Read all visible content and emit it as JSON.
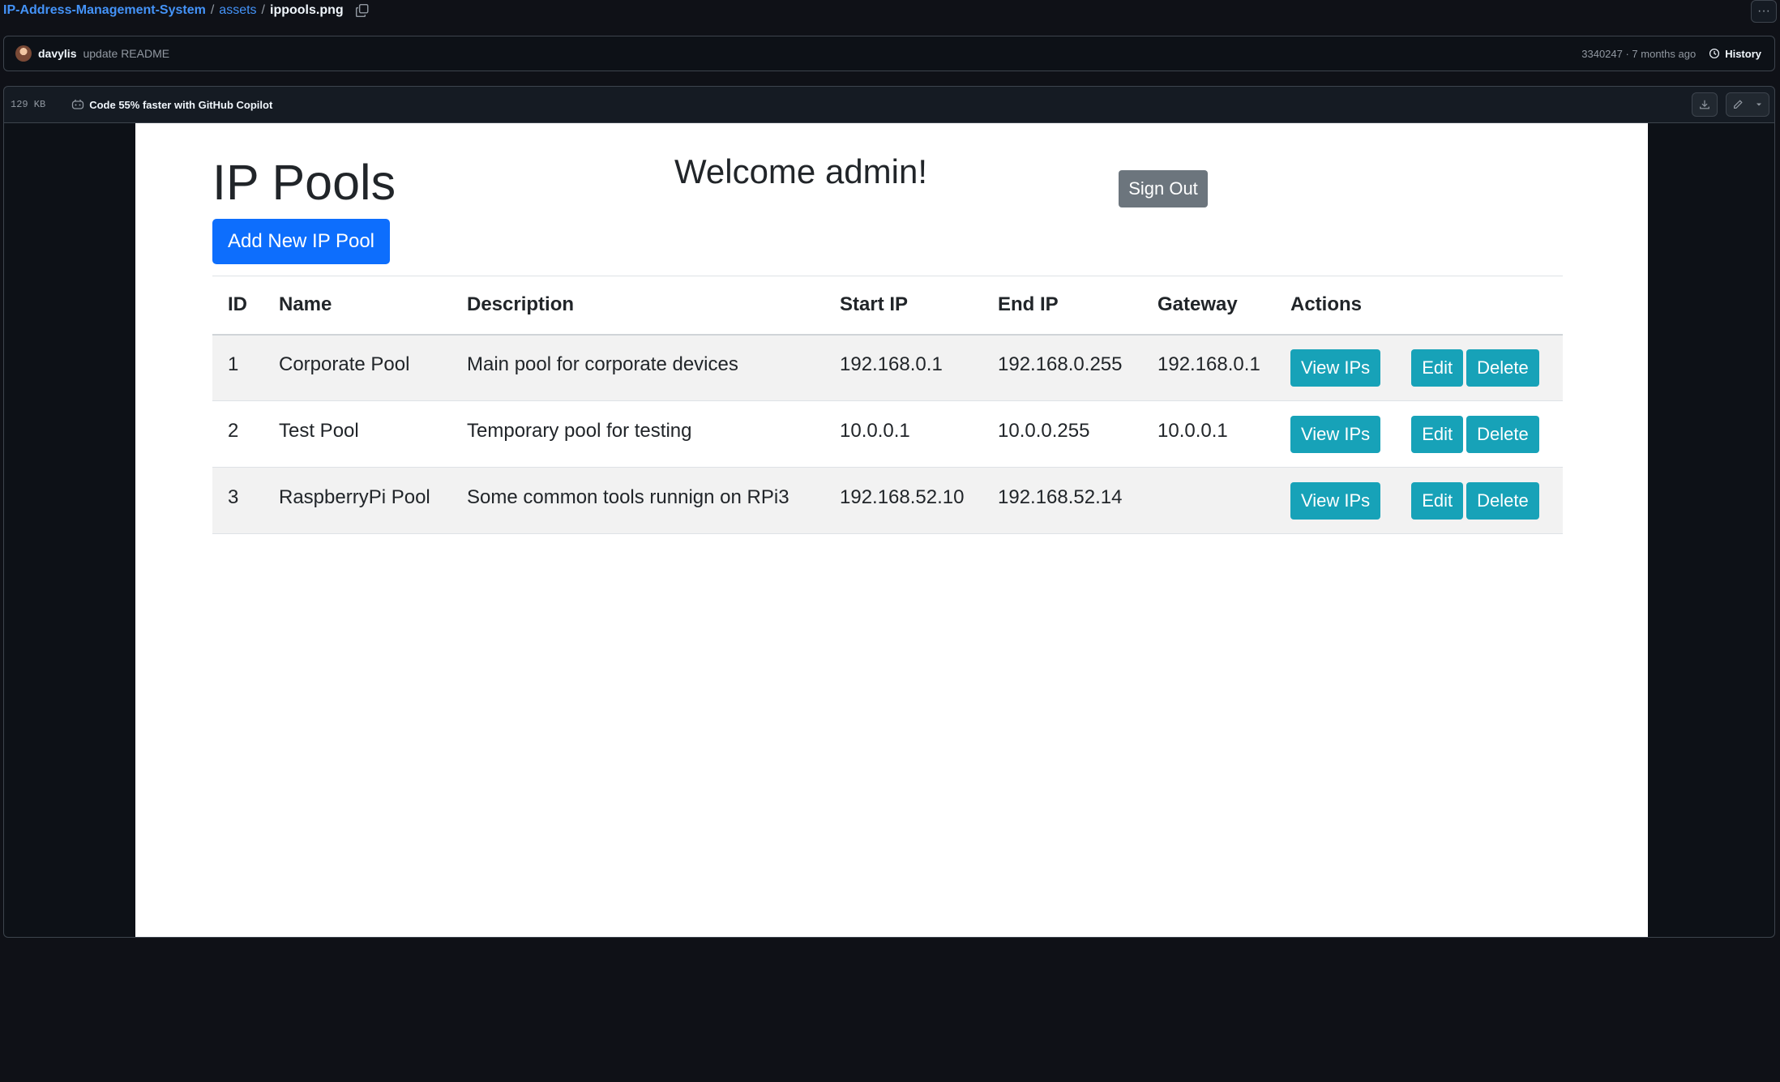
{
  "breadcrumb": {
    "repo": "IP-Address-Management-System",
    "folder": "assets",
    "file": "ippools.png",
    "separator": "/"
  },
  "commit": {
    "author": "davylis",
    "message": "update README",
    "meta": "3340247 · 7 months ago",
    "history_label": "History"
  },
  "file_header": {
    "size": "129 KB",
    "copilot_text": "Code 55% faster with GitHub Copilot"
  },
  "app": {
    "title": "IP Pools",
    "welcome": "Welcome admin!",
    "sign_out": "Sign Out",
    "add_button": "Add New IP Pool",
    "columns": [
      "ID",
      "Name",
      "Description",
      "Start IP",
      "End IP",
      "Gateway",
      "Actions"
    ],
    "rows": [
      {
        "id": "1",
        "name": "Corporate Pool",
        "description": "Main pool for corporate devices",
        "start_ip": "192.168.0.1",
        "end_ip": "192.168.0.255",
        "gateway": "192.168.0.1"
      },
      {
        "id": "2",
        "name": "Test Pool",
        "description": "Temporary pool for testing",
        "start_ip": "10.0.0.1",
        "end_ip": "10.0.0.255",
        "gateway": "10.0.0.1"
      },
      {
        "id": "3",
        "name": "RaspberryPi Pool",
        "description": "Some common tools runnign on RPi3",
        "start_ip": "192.168.52.10",
        "end_ip": "192.168.52.14",
        "gateway": ""
      }
    ],
    "actions": {
      "view": "View IPs",
      "edit": "Edit",
      "delete": "Delete"
    }
  },
  "colors": {
    "primary": "#0d6efd",
    "info": "#17a2b8",
    "secondary": "#6c757d",
    "github_link": "#4493f8",
    "github_bg": "#0f1117"
  }
}
